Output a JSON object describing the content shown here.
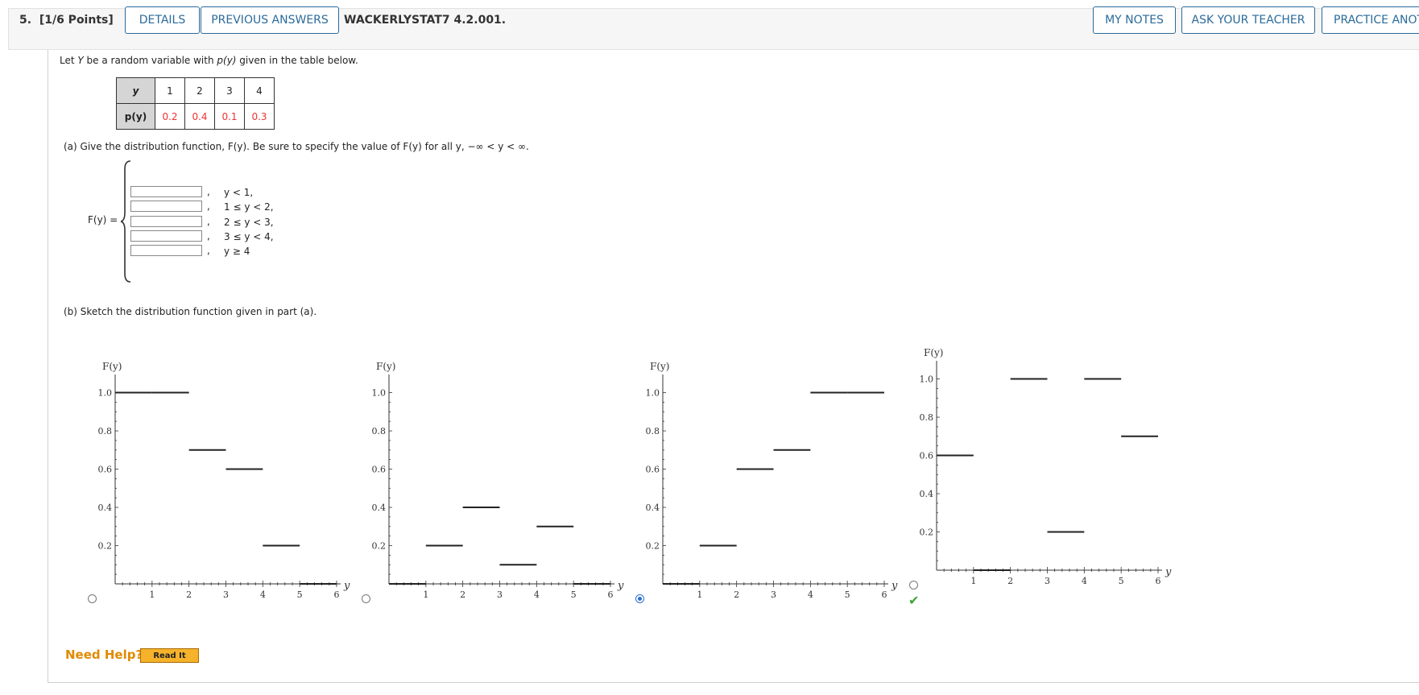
{
  "header": {
    "question_number": "5.",
    "points": "[1/6 Points]",
    "details_label": "DETAILS",
    "previous_answers_label": "PREVIOUS ANSWERS",
    "problem_code": "WACKERLYSTAT7 4.2.001.",
    "my_notes_label": "MY NOTES",
    "ask_teacher_label": "ASK YOUR TEACHER",
    "practice_label": "PRACTICE ANOTHER"
  },
  "intro": {
    "pre": "Let ",
    "var": "Y",
    "mid": " be a random variable with ",
    "fn": "p(y)",
    "post": " given in the table below."
  },
  "table": {
    "y_label": "y",
    "p_label": "p(y)",
    "y_values": [
      "1",
      "2",
      "3",
      "4"
    ],
    "p_values": [
      "0.2",
      "0.4",
      "0.1",
      "0.3"
    ]
  },
  "part_a": {
    "prompt": "(a)   Give the distribution function, F(y). Be sure to specify the value of F(y) for all y, −∞ < y < ∞.",
    "lhs": "F(y) =",
    "rows": [
      {
        "value": "",
        "cond": "y < 1,"
      },
      {
        "value": "",
        "cond": "1 ≤ y < 2,"
      },
      {
        "value": "",
        "cond": "2 ≤ y < 3,"
      },
      {
        "value": "",
        "cond": "3 ≤ y < 4,"
      },
      {
        "value": "",
        "cond": "y ≥ 4"
      }
    ],
    "comma": ","
  },
  "part_b": {
    "prompt": "(b)   Sketch the distribution function given in part (a)."
  },
  "chart_data": [
    {
      "type": "step",
      "ylabel": "F(y)",
      "xlabel": "y",
      "xlim": [
        0,
        6
      ],
      "ylim": [
        0,
        1
      ],
      "x_ticks": [
        "1",
        "2",
        "3",
        "4",
        "5",
        "6"
      ],
      "y_ticks": [
        "0.2",
        "0.4",
        "0.6",
        "0.8",
        "1.0"
      ],
      "segments": [
        [
          0,
          1,
          1.0
        ],
        [
          1,
          2,
          1.0
        ],
        [
          2,
          3,
          0.7
        ],
        [
          3,
          4,
          0.6
        ],
        [
          4,
          5,
          0.2
        ],
        [
          5,
          6,
          0
        ]
      ],
      "selected": false
    },
    {
      "type": "step",
      "ylabel": "F(y)",
      "xlabel": "y",
      "xlim": [
        0,
        6
      ],
      "ylim": [
        0,
        1
      ],
      "x_ticks": [
        "1",
        "2",
        "3",
        "4",
        "5",
        "6"
      ],
      "y_ticks": [
        "0.2",
        "0.4",
        "0.6",
        "0.8",
        "1.0"
      ],
      "segments": [
        [
          0,
          1,
          0
        ],
        [
          1,
          2,
          0.2
        ],
        [
          2,
          3,
          0.4
        ],
        [
          3,
          4,
          0.1
        ],
        [
          4,
          5,
          0.3
        ],
        [
          5,
          6,
          0
        ]
      ],
      "selected": false
    },
    {
      "type": "step",
      "ylabel": "F(y)",
      "xlabel": "y",
      "xlim": [
        0,
        6
      ],
      "ylim": [
        0,
        1
      ],
      "x_ticks": [
        "1",
        "2",
        "3",
        "4",
        "5",
        "6"
      ],
      "y_ticks": [
        "0.2",
        "0.4",
        "0.6",
        "0.8",
        "1.0"
      ],
      "segments": [
        [
          0,
          1,
          0
        ],
        [
          1,
          2,
          0.2
        ],
        [
          2,
          3,
          0.6
        ],
        [
          3,
          4,
          0.7
        ],
        [
          4,
          5,
          1.0
        ],
        [
          5,
          6,
          1.0
        ]
      ],
      "selected": true
    },
    {
      "type": "step",
      "ylabel": "F(y)",
      "xlabel": "y",
      "xlim": [
        0,
        6
      ],
      "ylim": [
        0,
        1
      ],
      "x_ticks": [
        "1",
        "2",
        "3",
        "4",
        "5",
        "6"
      ],
      "y_ticks": [
        "0.2",
        "0.4",
        "0.6",
        "0.8",
        "1.0"
      ],
      "segments": [
        [
          0,
          1,
          0.6
        ],
        [
          1,
          2,
          0
        ],
        [
          2,
          3,
          1.0
        ],
        [
          3,
          4,
          0.2
        ],
        [
          4,
          5,
          1.0
        ],
        [
          5,
          6,
          0.7
        ]
      ],
      "selected": false
    }
  ],
  "correct_mark": "✔",
  "help": {
    "label": "Need Help?",
    "read_it_label": "Read It"
  }
}
